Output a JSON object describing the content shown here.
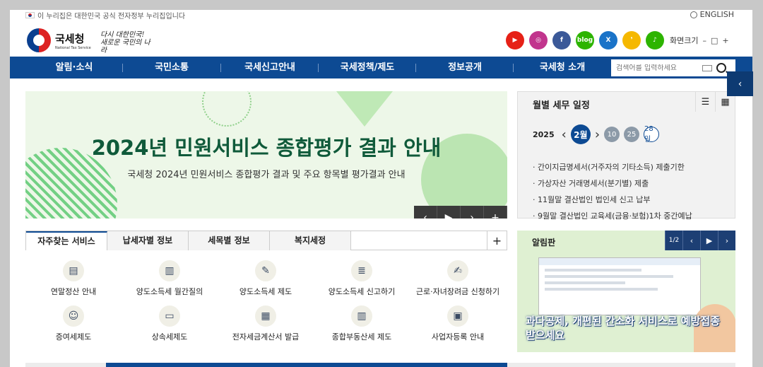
{
  "top": {
    "gov_notice": "이 누리집은 대한민국 공식 전자정부 누리집입니다",
    "language": "ENGLISH"
  },
  "header": {
    "logo_name": "국세청",
    "logo_sub": "National Tax Service",
    "slogan": "다시 대한민국! 새로운 국민의 나라",
    "font_size_label": "화면크기",
    "font_size_controls": [
      "–",
      "□",
      "+"
    ],
    "socials": [
      {
        "icon": "youtube-icon",
        "glyph": "▶",
        "color": "#e62117"
      },
      {
        "icon": "instagram-icon",
        "glyph": "◎",
        "color": "#c1358d"
      },
      {
        "icon": "facebook-icon",
        "glyph": "f",
        "color": "#3b5998"
      },
      {
        "icon": "blog-icon",
        "glyph": "blog",
        "color": "#2db400"
      },
      {
        "icon": "x-icon",
        "glyph": "X",
        "color": "#1a73c8"
      },
      {
        "icon": "kakao-story-icon",
        "glyph": "❜",
        "color": "#f5b800"
      },
      {
        "icon": "kakao-channel-icon",
        "glyph": "♪",
        "color": "#2db400"
      }
    ]
  },
  "gnb": {
    "items": [
      "알림·소식",
      "국민소통",
      "국세신고안내",
      "국세정책/제도",
      "정보공개",
      "국세청 소개"
    ],
    "search_placeholder": "검색어를 입력하세요"
  },
  "banner": {
    "title": "2024년 민원서비스 종합평가 결과 안내",
    "subtitle": "국세청 2024년 민원서비스 종합평가 결과 및 주요 항목별 평가결과 안내",
    "controls": [
      "‹",
      "▶",
      "›",
      "+"
    ]
  },
  "schedule": {
    "title": "월별 세무 일정",
    "year": "2025",
    "current_month": "2월",
    "days": [
      "10",
      "25",
      "28일"
    ],
    "items": [
      "간이지급명세서(거주자의 기타소득) 제출기한",
      "가상자산 거래명세서(분기별) 제출",
      "11월말 결산법인 법인세 신고 납부",
      "9월말 결산법인 교육세(금융·보험)1차 중간예납"
    ]
  },
  "services": {
    "tabs": [
      "자주찾는 서비스",
      "납세자별 정보",
      "세목별 정보",
      "복지세정"
    ],
    "plus": "+",
    "items": [
      {
        "label": "연말정산 안내",
        "icon": "calculator-icon",
        "glyph": "▤"
      },
      {
        "label": "양도소득세 월간질의",
        "icon": "building-icon",
        "glyph": "▥"
      },
      {
        "label": "양도소득세 제도",
        "icon": "document-pen-icon",
        "glyph": "✎"
      },
      {
        "label": "양도소득세 신고하기",
        "icon": "form-icon",
        "glyph": "≣"
      },
      {
        "label": "근로·자녀장려금 신청하기",
        "icon": "application-icon",
        "glyph": "✍"
      },
      {
        "label": "증여세제도",
        "icon": "people-icon",
        "glyph": "☺"
      },
      {
        "label": "상속세제도",
        "icon": "monitor-icon",
        "glyph": "▭"
      },
      {
        "label": "전자세금계산서 발급",
        "icon": "calculator-icon",
        "glyph": "▦"
      },
      {
        "label": "종합부동산세 제도",
        "icon": "apartment-icon",
        "glyph": "▥"
      },
      {
        "label": "사업자등록 안내",
        "icon": "certificate-icon",
        "glyph": "▣"
      }
    ]
  },
  "board": {
    "title": "알림판",
    "page_current": "1",
    "page_total": "2",
    "controls": [
      "‹",
      "▶",
      "›"
    ],
    "caption": "과다공제, 개편된 간소화 서비스로 예방접종 받으세요"
  }
}
